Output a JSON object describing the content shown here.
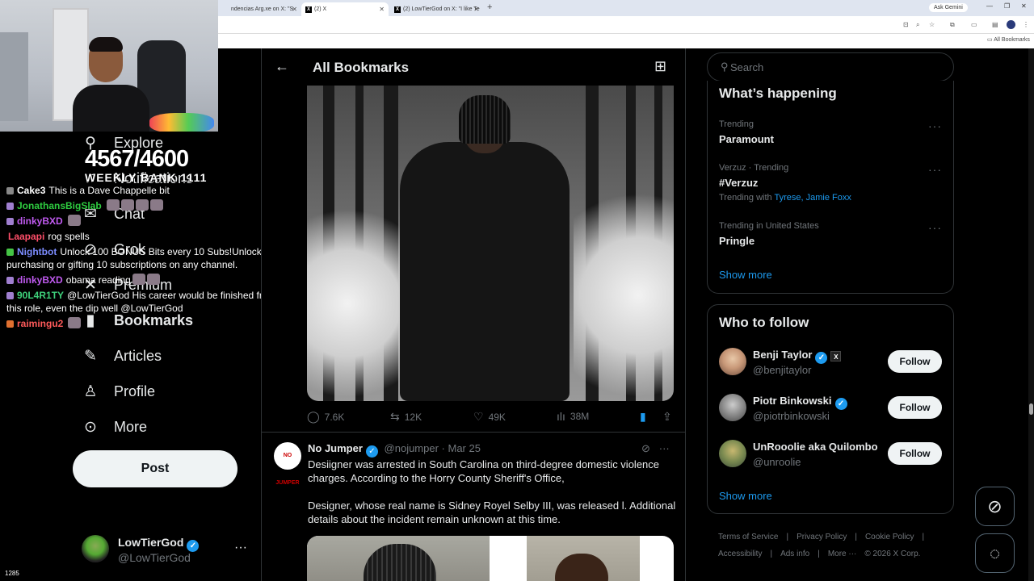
{
  "browser": {
    "tabs": [
      {
        "label": "ndencias Arg.xe on X: \"S",
        "active": false
      },
      {
        "label": "(2) X",
        "active": true
      },
      {
        "label": "(2) LowTierGod on X: \"I like Te",
        "active": false
      }
    ],
    "new_tab": "+",
    "ask_gemini": "Ask Gemini",
    "bookmarks_bar": "All Bookmarks"
  },
  "stream": {
    "sub_goal": "4567/4600",
    "weekly_label": "WEEKLY BANK 1111",
    "viewers": "1285",
    "chat": [
      {
        "user": "Cake3",
        "color": "#ffffff",
        "text": "This is a Dave Chappelle bit",
        "badge": "#888888"
      },
      {
        "user": "JonathansBigSlab",
        "color": "#2ecc40",
        "text": "",
        "badge": "#a07fd0",
        "emotes": 4
      },
      {
        "user": "dinkyBXD",
        "color": "#c05af0",
        "text": "",
        "badge": "#a07fd0",
        "emotes": 1
      },
      {
        "user": "Laapapi",
        "color": "#ff4f6a",
        "text": "rog spells",
        "badge": ""
      },
      {
        "user": "Nightbot",
        "color": "#7c8cff",
        "text": "Unlock 100 BONUS Bits every 10 Subs!Unlock Bits by purchasing or gifting 10 subscriptions on any channel.",
        "badge": "#45c445"
      },
      {
        "user": "dinkyBXD",
        "color": "#c05af0",
        "text": "obama reading",
        "badge": "#a07fd0",
        "emotes": 2
      },
      {
        "user": "90L4R1TY",
        "color": "#3ed07a",
        "text": "@LowTierGod His career would be finished from accepting this role, even the dip well @LowTierGod",
        "badge": "#a07fd0"
      },
      {
        "user": "raimingu2",
        "color": "#ff5a5a",
        "text": "",
        "badge": "#e07030",
        "emotes": 1
      }
    ]
  },
  "nav": {
    "items": [
      {
        "label": "Explore",
        "icon": "search-icon"
      },
      {
        "label": "Notifications",
        "icon": "bell-icon"
      },
      {
        "label": "Chat",
        "icon": "mail-icon"
      },
      {
        "label": "Grok",
        "icon": "grok-icon"
      },
      {
        "label": "Premium",
        "icon": "x-icon"
      },
      {
        "label": "Bookmarks",
        "icon": "bookmark-icon"
      },
      {
        "label": "Articles",
        "icon": "article-icon"
      },
      {
        "label": "Profile",
        "icon": "person-icon"
      },
      {
        "label": "More",
        "icon": "more-circle-icon"
      }
    ],
    "post_label": "Post",
    "account": {
      "name": "LowTierGod",
      "handle": "@LowTierGod"
    }
  },
  "main": {
    "title": "All Bookmarks",
    "tweet1_stats": {
      "replies": "7.6K",
      "reposts": "12K",
      "likes": "49K",
      "views": "38M"
    },
    "tweet2": {
      "name": "No Jumper",
      "handle": "@nojumper",
      "date": "Mar 25",
      "avatar_text": "NO JUMPER",
      "para1": "Desiigner was arrested in South Carolina on third-degree domestic violence charges. According to the Horry County Sheriff's Office,",
      "para2": "Designer, whose real name is Sidney Royel Selby III, was released l. Additional details about the incident remain unknown at this time."
    }
  },
  "sidebar": {
    "search_placeholder": "Search",
    "happening_title": "What’s happening",
    "trends": [
      {
        "meta": "Trending",
        "name": "Paramount",
        "with_label": "",
        "with": ""
      },
      {
        "meta": "Verzuz · Trending",
        "name": "#Verzuz",
        "with_label": "Trending with",
        "with": "Tyrese, Jamie Foxx"
      },
      {
        "meta": "Trending in United States",
        "name": "Pringle",
        "with_label": "",
        "with": ""
      }
    ],
    "show_more": "Show more",
    "who_title": "Who to follow",
    "follow": [
      {
        "name": "Benji Taylor",
        "handle": "@benjitaylor"
      },
      {
        "name": "Piotr Binkowski",
        "handle": "@piotrbinkowski"
      },
      {
        "name": "UnRooolie aka Quilombo",
        "handle": "@unroolie"
      }
    ],
    "follow_label": "Follow",
    "footer": [
      "Terms of Service",
      "|",
      "Privacy Policy",
      "|",
      "Cookie Policy",
      "|",
      "Accessibility",
      "|",
      "Ads info",
      "|",
      "More ···",
      "© 2026 X Corp."
    ]
  },
  "colors": {
    "accent": "#1d9bf0",
    "border": "#2f3336",
    "muted": "#71767b"
  }
}
